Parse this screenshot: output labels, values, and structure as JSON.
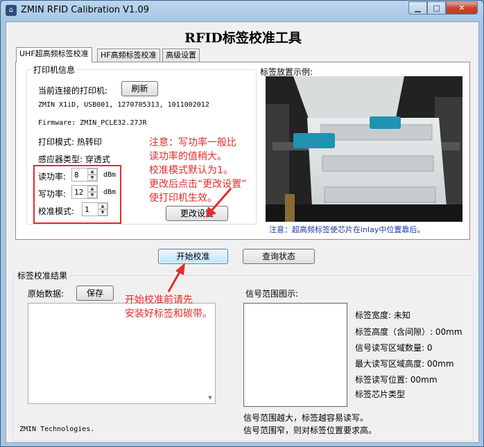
{
  "window": {
    "title": "ZMIN RFID Calibration V1.09",
    "controls": {
      "minimize": "▁",
      "maximize": "□",
      "close": "✕"
    }
  },
  "header": {
    "title": "RFID标签校准工具"
  },
  "tabs": [
    {
      "label": "UHF超高频标签校准",
      "active": true
    },
    {
      "label": "HF高频标签校准",
      "active": false
    },
    {
      "label": "高级设置",
      "active": false
    }
  ],
  "printer_group": {
    "legend": "打印机信息",
    "connected_label": "当前连接的打印机:",
    "refresh_button": "刷新",
    "printer_info": "ZMIN X1iD, USB001, 1270705313, 1011002012",
    "firmware": "Firmware: ZMIN_PCLE32.27JR",
    "print_mode": "打印模式: 热转印",
    "sensor_type": "感应器类型: 穿透式",
    "read_power_label": "读功率:",
    "read_power_value": "8",
    "write_power_label": "写功率:",
    "write_power_value": "12",
    "unit_dbm": "dBm",
    "calib_mode_label": "校准模式:",
    "calib_mode_value": "1",
    "change_settings_button": "更改设置"
  },
  "annotation_top": {
    "lines": [
      "注意：写功率一般比",
      "读功率的值稍大。",
      "校准模式默认为1。",
      "更改后点击“更改设置”",
      "使打印机生效。"
    ]
  },
  "sample": {
    "title": "标签放置示例:",
    "caption": "注意：超高频标签使芯片在inlay中位置靠后。"
  },
  "actions": {
    "start_button": "开始校准",
    "status_button": "查询状态"
  },
  "annotation_bottom": {
    "lines": [
      "开始校准前请先",
      "安装好标签和碳带。"
    ]
  },
  "result_group": {
    "legend": "标签校准结果",
    "raw_data_label": "原始数据:",
    "save_button": "保存",
    "signal_range_label": "信号范围图示:",
    "label_width": "标签宽度: 未知",
    "label_height": "标签高度（含间隙）: 00mm",
    "rw_zone_count": "信号读写区域数量: 0",
    "max_rw_height": "最大读写区域高度: 00mm",
    "rw_position": "标签读写位置: 00mm",
    "chip_type": "标签芯片类型",
    "hint_wide": "信号范围越大，标签越容易读写。",
    "hint_narrow": "信号范围窄，则对标签位置要求高。"
  },
  "footer": {
    "company": "ZMIN Technologies."
  },
  "colors": {
    "annotation": "#e32b2b",
    "caption": "#1a3aa0",
    "title_blue": "#a7c5e4"
  }
}
